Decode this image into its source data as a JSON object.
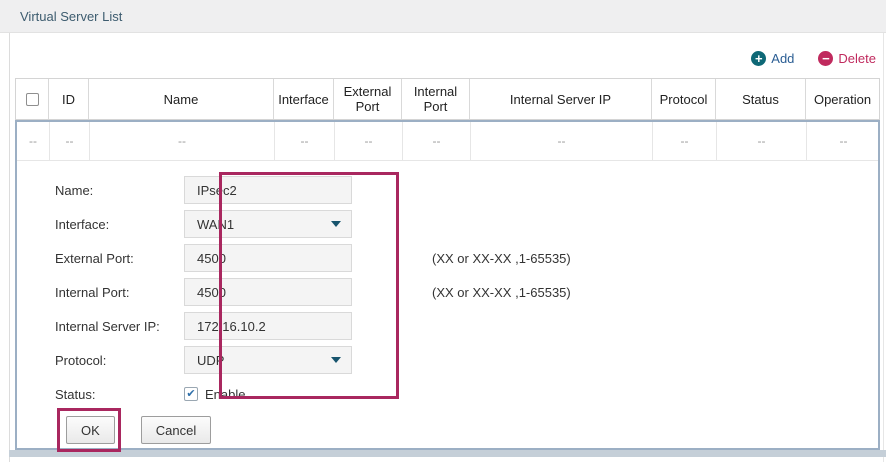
{
  "title": "Virtual Server List",
  "toolbar": {
    "add_label": "Add",
    "delete_label": "Delete",
    "add_glyph": "+",
    "delete_glyph": "−"
  },
  "table": {
    "headers": [
      "ID",
      "Name",
      "Interface",
      "External Port",
      "Internal Port",
      "Internal Server IP",
      "Protocol",
      "Status",
      "Operation"
    ],
    "empty_row": [
      "--",
      "--",
      "--",
      "--",
      "--",
      "--",
      "--",
      "--",
      "--",
      "--"
    ]
  },
  "form": {
    "fields": [
      {
        "label": "Name:",
        "value": "IPsec2",
        "type": "text"
      },
      {
        "label": "Interface:",
        "value": "WAN1",
        "type": "select"
      },
      {
        "label": "External Port:",
        "value": "4500",
        "type": "text",
        "hint": "(XX or XX-XX ,1-65535)"
      },
      {
        "label": "Internal Port:",
        "value": "4500",
        "type": "text",
        "hint": "(XX or XX-XX ,1-65535)"
      },
      {
        "label": "Internal Server IP:",
        "value": "172.16.10.2",
        "type": "text"
      },
      {
        "label": "Protocol:",
        "value": "UDP",
        "type": "select"
      },
      {
        "label": "Status:",
        "checkbox_label": "Enable",
        "checked": true,
        "check_glyph": "✔",
        "type": "checkbox"
      }
    ],
    "ok_label": "OK",
    "cancel_label": "Cancel"
  },
  "colors": {
    "annotation": "#a9275f",
    "add_icon": "#0e6876",
    "delete_accent": "#c02a5e",
    "link_blue": "#2a5d93",
    "title_text": "#3d5c6f",
    "selected_row_border": "#9cafc4",
    "dropdown_arrow": "#17546d",
    "checkbox_check": "#2e6faa",
    "titlebar_bg": "#efeff0",
    "input_bg": "#f4f4f4"
  }
}
